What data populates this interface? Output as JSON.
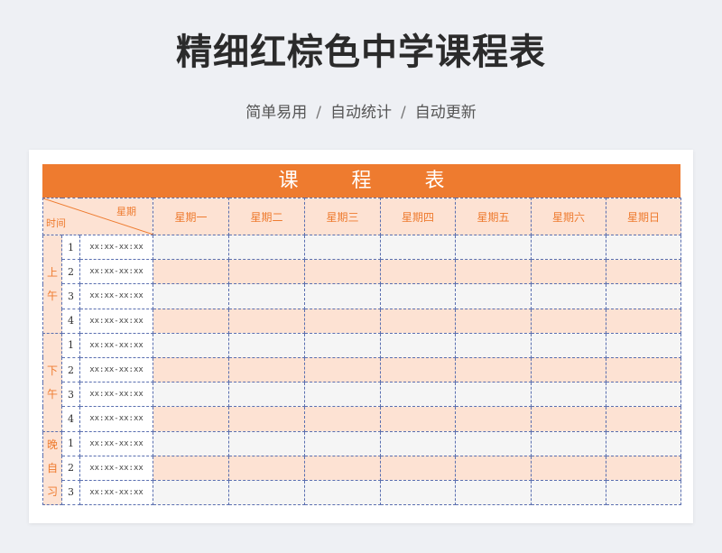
{
  "header": {
    "title": "精细红棕色中学课程表",
    "subtitle_items": [
      "简单易用",
      "自动统计",
      "自动更新"
    ],
    "separator": "/"
  },
  "table": {
    "banner": "课 程 表",
    "corner_top": "星期",
    "corner_bottom": "时间",
    "days": [
      "星期一",
      "星期二",
      "星期三",
      "星期四",
      "星期五",
      "星期六",
      "星期日"
    ],
    "time_placeholder": "xx:xx-xx:xx",
    "periods": [
      {
        "label_chars": [
          "上",
          "午"
        ],
        "slots": [
          "1",
          "2",
          "3",
          "4"
        ]
      },
      {
        "label_chars": [
          "下",
          "午"
        ],
        "slots": [
          "1",
          "2",
          "3",
          "4"
        ]
      },
      {
        "label_chars": [
          "晚",
          "自",
          "习"
        ],
        "slots": [
          "1",
          "2",
          "3"
        ]
      }
    ]
  },
  "colors": {
    "accent": "#ee7b2f",
    "light_band": "#fde2d3",
    "grey_band": "#f5f5f5",
    "grid_line": "#5a6fb0",
    "background": "#eef0f4"
  }
}
